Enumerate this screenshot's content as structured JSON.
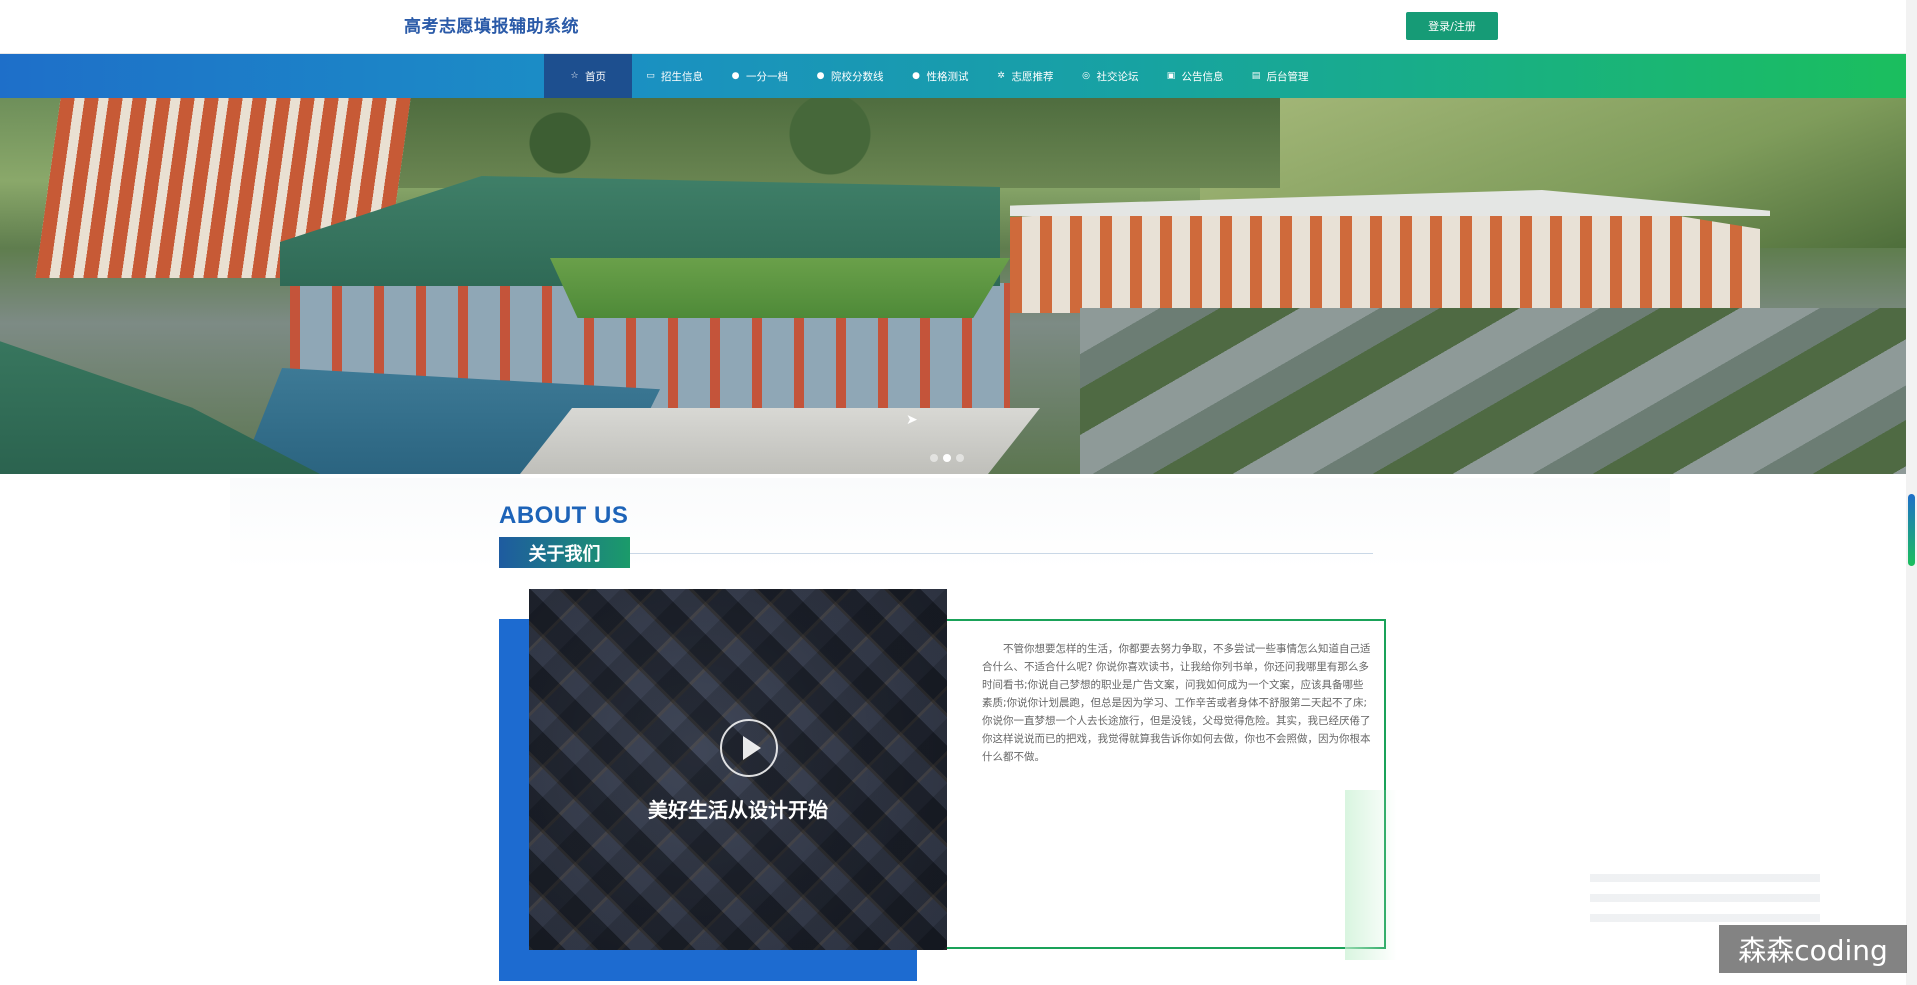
{
  "header": {
    "site_title": "高考志愿填报辅助系统",
    "login_label": "登录/注册"
  },
  "nav": {
    "items": [
      {
        "label": "首页",
        "icon": "star-icon",
        "glyph": "☆",
        "active": true
      },
      {
        "label": "招生信息",
        "icon": "clipboard-icon",
        "glyph": "▭",
        "active": false
      },
      {
        "label": "一分一档",
        "icon": "circle-icon",
        "glyph": "●",
        "active": false
      },
      {
        "label": "院校分数线",
        "icon": "circle-icon",
        "glyph": "●",
        "active": false
      },
      {
        "label": "性格测试",
        "icon": "info-icon",
        "glyph": "●",
        "active": false
      },
      {
        "label": "志愿推荐",
        "icon": "gear-icon",
        "glyph": "✲",
        "active": false
      },
      {
        "label": "社交论坛",
        "icon": "globe-icon",
        "glyph": "◎",
        "active": false
      },
      {
        "label": "公告信息",
        "icon": "camera-icon",
        "glyph": "▣",
        "active": false
      },
      {
        "label": "后台管理",
        "icon": "document-icon",
        "glyph": "▤",
        "active": false
      }
    ]
  },
  "banner": {
    "slide_count": 3,
    "active_slide": 2
  },
  "about": {
    "title_en": "ABOUT US",
    "title_cn": "关于我们",
    "video_caption": "美好生活从设计开始",
    "body": "不管你想要怎样的生活，你都要去努力争取，不多尝试一些事情怎么知道自己适合什么、不适合什么呢? 你说你喜欢读书，让我给你列书单，你还问我哪里有那么多时间看书;你说自己梦想的职业是广告文案，问我如何成为一个文案，应该具备哪些素质;你说你计划晨跑，但总是因为学习、工作辛苦或者身体不舒服第二天起不了床;你说你一直梦想一个人去长途旅行，但是没钱，父母觉得危险。其实，我已经厌倦了你这样说说而已的把戏，我觉得就算我告诉你如何去做，你也不会照做，因为你根本什么都不做。"
  },
  "watermark": "森森coding",
  "colors": {
    "brand_blue": "#1d63b8",
    "nav_gradient_start": "#1e6fc9",
    "nav_gradient_end": "#1bbf5d",
    "login_green": "#169b76",
    "card_border_green": "#1aa259"
  }
}
